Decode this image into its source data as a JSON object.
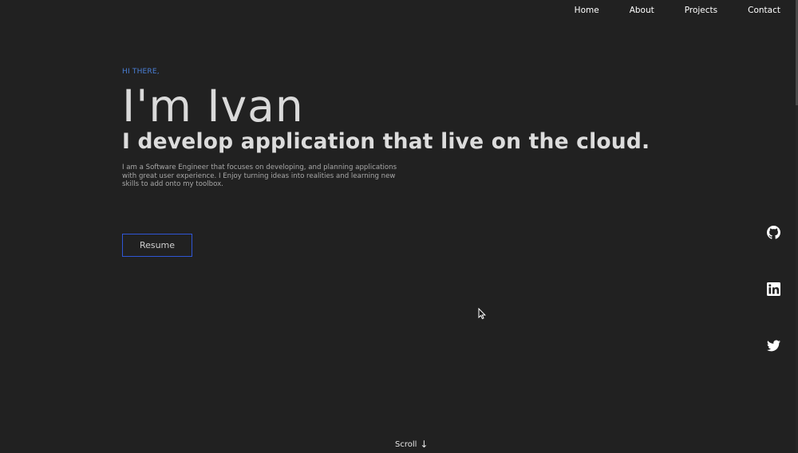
{
  "nav": {
    "items": [
      {
        "label": "Home"
      },
      {
        "label": "About"
      },
      {
        "label": "Projects"
      },
      {
        "label": "Contact"
      }
    ]
  },
  "hero": {
    "greeting": "HI THERE,",
    "name": "I'm Ivan",
    "tagline": "I develop application that live on the cloud.",
    "bio": "I am a Software Engineer that focuses on developing, and planning applications with great user experience. I Enjoy turning ideas into realities and learning new skills to add onto my toolbox.",
    "resume_label": "Resume"
  },
  "social": {
    "icons": [
      "github-icon",
      "linkedin-icon",
      "twitter-icon"
    ]
  },
  "scroll": {
    "label": "Scroll",
    "arrow": "↓"
  },
  "colors": {
    "background": "#212121",
    "accent_blue": "#4a7fd6",
    "button_border": "#2f56d6",
    "text": "#dcdcdc"
  }
}
